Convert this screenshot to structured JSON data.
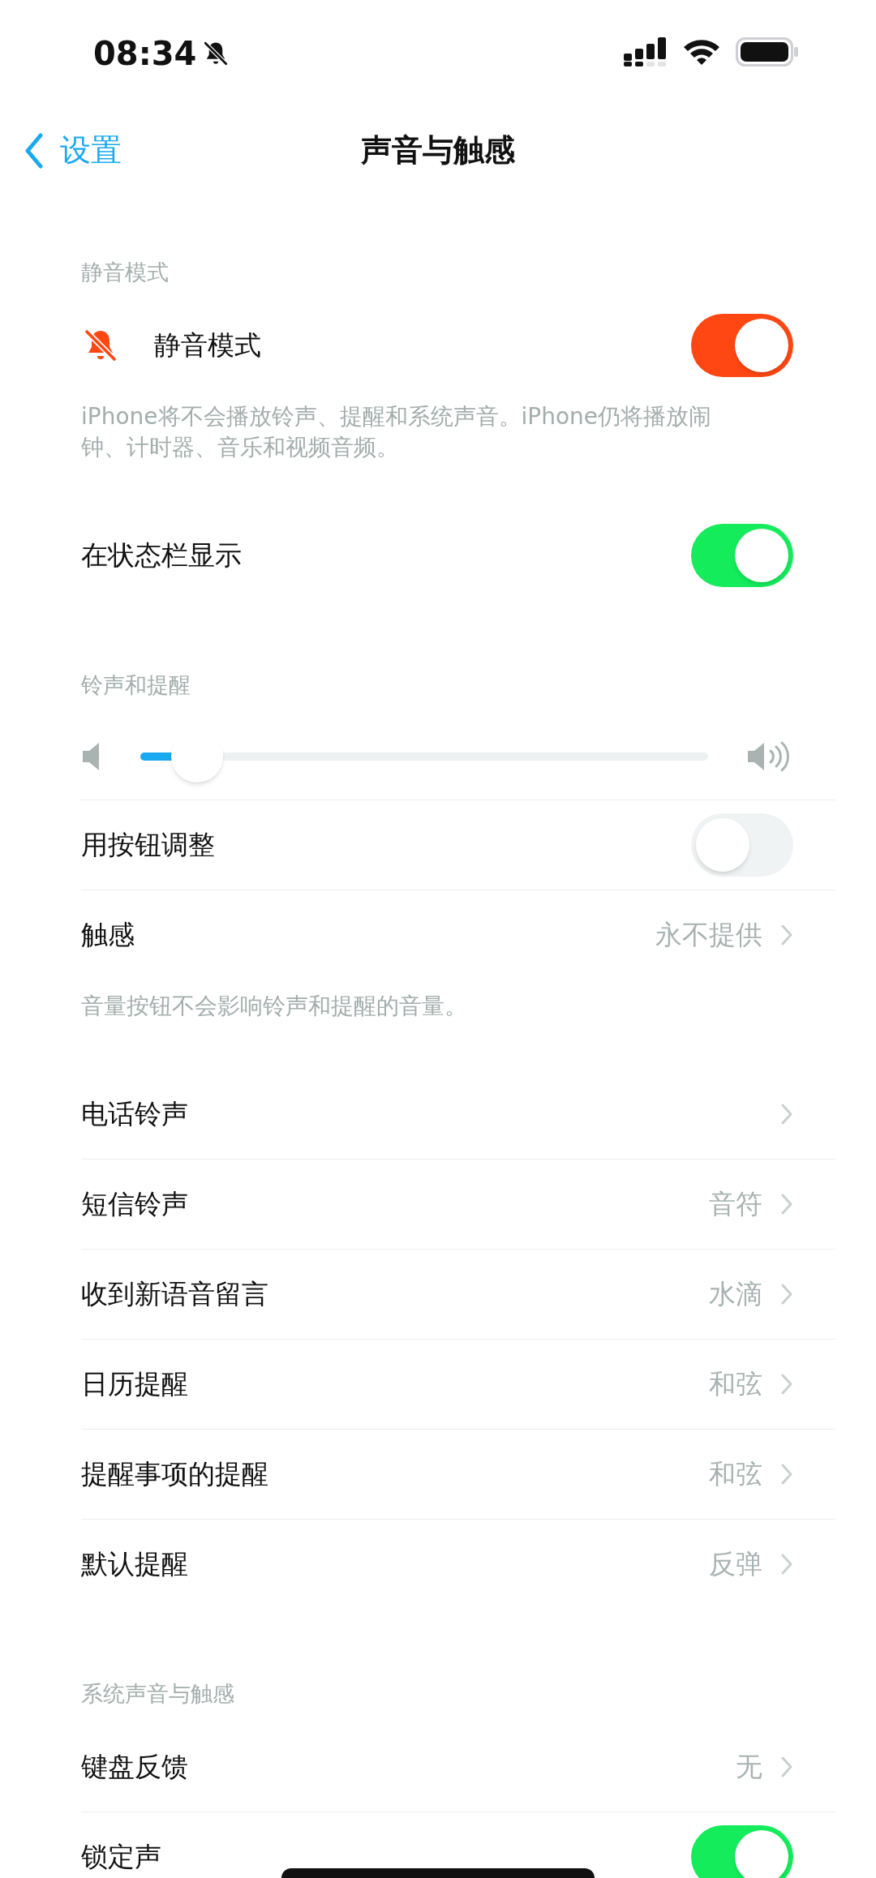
{
  "status_bar": {
    "time": "08:34"
  },
  "nav": {
    "back": "设置",
    "title": "声音与触感"
  },
  "sections": [
    {
      "header": "静音模式",
      "items": [
        {
          "kind": "icon-toggle",
          "label": "静音模式",
          "on": true,
          "color": "#ff4713"
        }
      ],
      "footer": "iPhone将不会播放铃声、提醒和系统声音。iPhone仍将播放闹钟、计时器、音乐和视频音频。"
    },
    {
      "items": [
        {
          "kind": "toggle",
          "label": "在状态栏显示",
          "on": true,
          "color": "#14ec5b"
        }
      ]
    },
    {
      "header": "铃声和提醒",
      "items": [
        {
          "kind": "slider",
          "level": 0.1
        },
        {
          "kind": "toggle",
          "label": "用按钮调整",
          "on": false
        },
        {
          "kind": "link",
          "label": "触感",
          "value": "永不提供"
        }
      ],
      "footer": "音量按钮不会影响铃声和提醒的音量。"
    },
    {
      "items": [
        {
          "kind": "link",
          "label": "电话铃声"
        },
        {
          "kind": "link",
          "label": "短信铃声",
          "value": "音符"
        },
        {
          "kind": "link",
          "label": "收到新语音留言",
          "value": "水滴"
        },
        {
          "kind": "link",
          "label": "日历提醒",
          "value": "和弦"
        },
        {
          "kind": "link",
          "label": "提醒事项的提醒",
          "value": "和弦"
        },
        {
          "kind": "link",
          "label": "默认提醒",
          "value": "反弹"
        }
      ]
    },
    {
      "header": "系统声音与触感",
      "items": [
        {
          "kind": "link",
          "label": "键盘反馈",
          "value": "无"
        },
        {
          "kind": "toggle",
          "label": "锁定声",
          "on": true,
          "color": "#14ec5b"
        }
      ]
    }
  ]
}
